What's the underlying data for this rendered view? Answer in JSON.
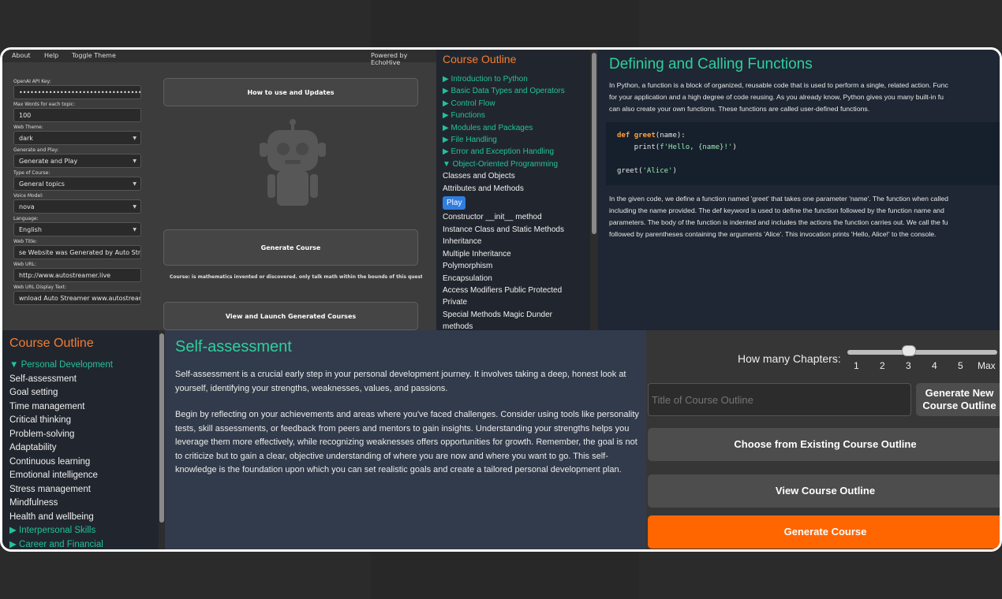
{
  "app": {
    "menu": [
      "About",
      "Help",
      "Toggle Theme"
    ],
    "powered_by": "Powered by EchoHive",
    "fields": [
      {
        "label": "OpenAI API Key:",
        "value": "••••••••••••••••••••••••••••••••••••"
      },
      {
        "label": "Max Words for each topic:",
        "value": "100"
      },
      {
        "label": "Web Theme:",
        "value": "dark"
      },
      {
        "label": "Generate and Play:",
        "value": "Generate and Play"
      },
      {
        "label": "Type of Course:",
        "value": "General topics"
      },
      {
        "label": "Voice Model:",
        "value": "nova"
      },
      {
        "label": "Language:",
        "value": "English"
      },
      {
        "label": "Web Title:",
        "value": "se Website was Generated by Auto Streamer"
      },
      {
        "label": "Web URL:",
        "value": "http://www.autostreamer.live"
      },
      {
        "label": "Web URL Display Text:",
        "value": "wnload Auto Streamer www.autostreamer.live"
      }
    ],
    "buttons": {
      "how_to": "How to use and Updates",
      "generate": "Generate Course",
      "view": "View and Launch Generated Courses"
    },
    "course_status": "Course: is mathematics invented or discovered. only talk math within the bounds of this question_curr"
  },
  "outline1": {
    "title": "Course Outline",
    "items": [
      {
        "text": "▶ Introduction to Python",
        "style": "teal"
      },
      {
        "text": "▶ Basic Data Types and Operators",
        "style": "teal"
      },
      {
        "text": "▶ Control Flow",
        "style": "teal"
      },
      {
        "text": "▶ Functions",
        "style": "teal"
      },
      {
        "text": "▶ Modules and Packages",
        "style": "teal"
      },
      {
        "text": "▶ File Handling",
        "style": "teal"
      },
      {
        "text": "▶ Error and Exception Handling",
        "style": "teal"
      },
      {
        "text": "▼ Object-Oriented Programming",
        "style": "teal"
      },
      {
        "text": "Classes and Objects",
        "style": "white"
      },
      {
        "text": "Attributes and Methods",
        "style": "white"
      },
      {
        "text": "Play",
        "style": "play"
      },
      {
        "text": "Constructor __init__ method",
        "style": "white"
      },
      {
        "text": "Instance Class and Static Methods",
        "style": "white"
      },
      {
        "text": "Inheritance",
        "style": "white"
      },
      {
        "text": "Multiple Inheritance",
        "style": "white"
      },
      {
        "text": "Polymorphism",
        "style": "white"
      },
      {
        "text": "Encapsulation",
        "style": "white"
      },
      {
        "text": "Access Modifiers Public Protected",
        "style": "white"
      },
      {
        "text": "Private",
        "style": "white"
      },
      {
        "text": "Special Methods Magic Dunder",
        "style": "white"
      },
      {
        "text": "methods",
        "style": "white"
      }
    ]
  },
  "functions_doc": {
    "title": "Defining and Calling Functions",
    "intro": [
      "In Python, a function is a block of organized, reusable code that is used to perform a single, related action. Func",
      "for your application and a high degree of code reusing. As you already know, Python gives you many built-in fu",
      "can also create your own functions. These functions are called user-defined functions."
    ],
    "code": {
      "line1_kw": "def",
      "line1_name": "greet",
      "line1_rest": "(name):",
      "line2_pre": "    print(",
      "line2_str": "f'Hello, {name}!'",
      "line2_post": ")",
      "line4_pre": "greet(",
      "line4_str": "'Alice'",
      "line4_post": ")"
    },
    "explanation": [
      "In the given code, we define a function named 'greet' that takes one parameter 'name'. The function when called",
      "including the name provided. The def keyword is used to define the function followed by the function name and",
      "parameters. The body of the function is indented and includes the actions the function carries out. We call the fu",
      "followed by parentheses containing the arguments 'Alice'. This invocation prints 'Hello, Alice!' to the console."
    ]
  },
  "outline2": {
    "title": "Course Outline",
    "items": [
      {
        "text": "▼ Personal Development",
        "style": "teal"
      },
      {
        "text": "Self-assessment",
        "style": "white"
      },
      {
        "text": "Goal setting",
        "style": "white"
      },
      {
        "text": "Time management",
        "style": "white"
      },
      {
        "text": "Critical thinking",
        "style": "white"
      },
      {
        "text": "Problem-solving",
        "style": "white"
      },
      {
        "text": "Adaptability",
        "style": "white"
      },
      {
        "text": "Continuous learning",
        "style": "white"
      },
      {
        "text": "Emotional intelligence",
        "style": "white"
      },
      {
        "text": "Stress management",
        "style": "white"
      },
      {
        "text": "Mindfulness",
        "style": "white"
      },
      {
        "text": "Health and wellbeing",
        "style": "white"
      },
      {
        "text": "▶ Interpersonal Skills",
        "style": "teal"
      },
      {
        "text": "▶ Career and Financial",
        "style": "teal"
      }
    ]
  },
  "self_assessment": {
    "title": "Self-assessment",
    "p1": "Self-assessment is a crucial early step in your personal development journey. It involves taking a deep, honest look at yourself, identifying your strengths, weaknesses, values, and passions.",
    "p2": "Begin by reflecting on your achievements and areas where you've faced challenges. Consider using tools like personality tests, skill assessments, or feedback from peers and mentors to gain insights. Understanding your strengths helps you leverage them more effectively, while recognizing weaknesses offers opportunities for growth. Remember, the goal is not to criticize but to gain a clear, objective understanding of where you are now and where you want to go. This self-knowledge is the foundation upon which you can set realistic goals and create a tailored personal development plan."
  },
  "generator": {
    "chapters_label": "How many Chapters:",
    "ticks": [
      "1",
      "2",
      "3",
      "4",
      "5",
      "Max"
    ],
    "chapters_value": 3,
    "title_placeholder": "Title of Course Outline",
    "new_outline_button": "Generate New Course Outline",
    "choose_button": "Choose from Existing Course Outline",
    "view_button": "View Course Outline",
    "generate_button": "Generate Course",
    "accent": "#ff6600"
  }
}
